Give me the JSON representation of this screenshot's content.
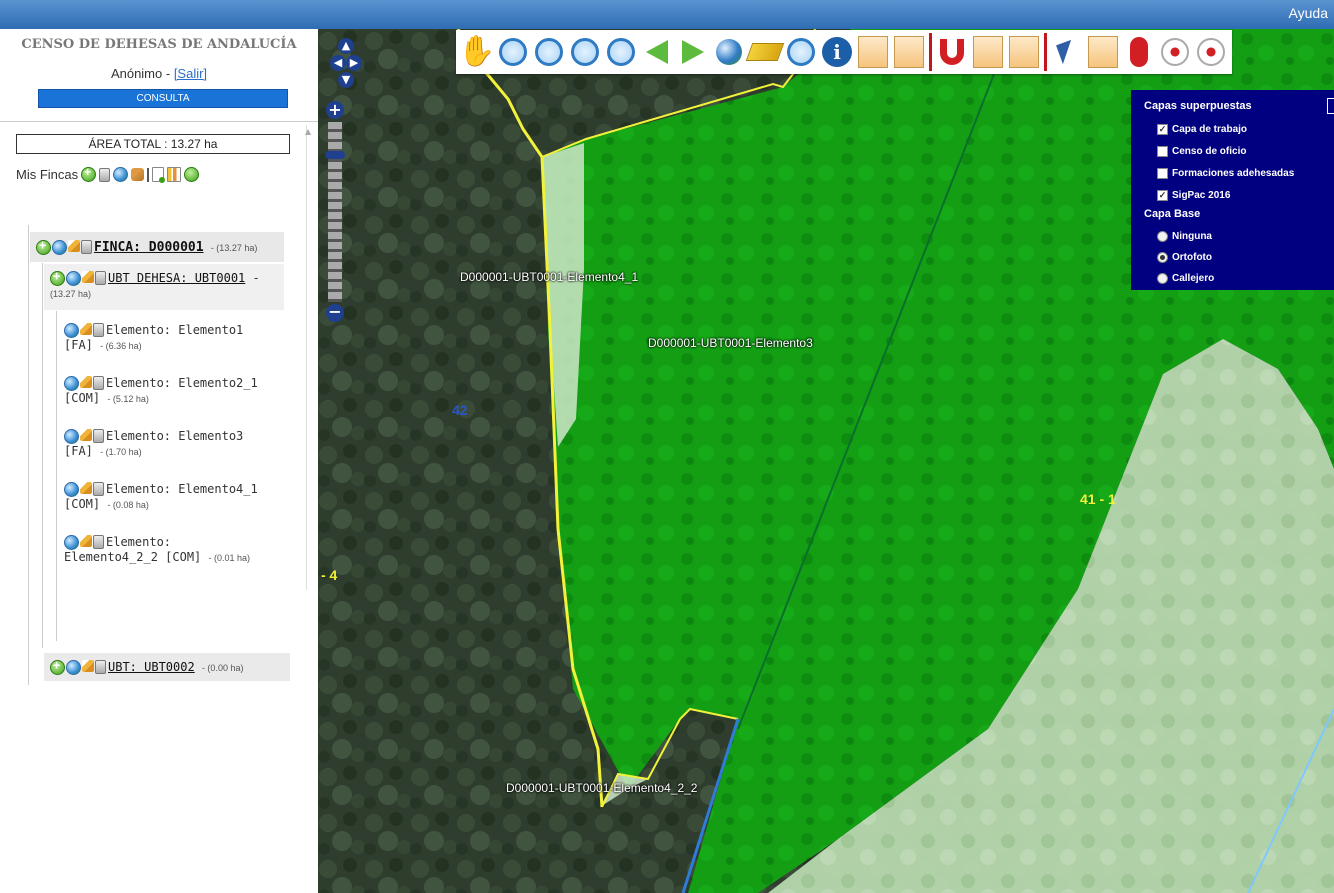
{
  "header": {
    "help_label": "Ayuda"
  },
  "sidebar": {
    "title": "CENSO DE DEHESAS DE ANDALUCÍA",
    "user": "Anónimo",
    "logout_label": "[Salir]",
    "mode": "CONSULTA",
    "area_total": "ÁREA TOTAL : 13.27 ha",
    "mis_fincas_label": "Mis Fincas",
    "tree": {
      "finca": {
        "label": "FINCA: D000001",
        "area": "- (13.27 ha)"
      },
      "ubt1": {
        "label": "UBT DEHESA: UBT0001",
        "suffix": "-",
        "area": "(13.27 ha)"
      },
      "elements": [
        {
          "label": "Elemento: Elemento1",
          "tag": "[FA]",
          "area": "- (6.36 ha)"
        },
        {
          "label": "Elemento: Elemento2_1",
          "tag": "[COM]",
          "area": "- (5.12 ha)"
        },
        {
          "label": "Elemento: Elemento3",
          "tag": "[FA]",
          "area": "- (1.70 ha)"
        },
        {
          "label": "Elemento: Elemento4_1",
          "tag": "[COM]",
          "area": "- (0.08 ha)"
        },
        {
          "label": "Elemento:",
          "tag": "Elemento4_2_2 [COM]",
          "area": "- (0.01 ha)"
        }
      ],
      "ubt2": {
        "label": "UBT: UBT0002",
        "area": "- (0.00 ha)"
      }
    }
  },
  "map": {
    "labels": {
      "el4_1": "D000001-UBT0001-Elemento4_1",
      "el3": "D000001-UBT0001-Elemento3",
      "el4_2_2": "D000001-UBT0001-Elemento4_2_2"
    },
    "parcel_numbers": {
      "p42": "42",
      "p41": "41 - 1",
      "p4": "- 4"
    },
    "colors": {
      "parcel_green": "#14a014",
      "parcel_light": "#c8e6c0",
      "boundary_yellow": "#f2f23a",
      "blue_line": "#2f7bd8",
      "panel_bg": "#000080"
    },
    "layer_panel": {
      "overlays_title": "Capas superpuestas",
      "overlays": [
        {
          "label": "Capa de trabajo",
          "checked": true
        },
        {
          "label": "Censo de oficio",
          "checked": false
        },
        {
          "label": "Formaciones adehesadas",
          "checked": false
        },
        {
          "label": "SigPac 2016",
          "checked": true
        }
      ],
      "base_title": "Capa Base",
      "base": [
        {
          "label": "Ninguna",
          "selected": false
        },
        {
          "label": "Ortofoto",
          "selected": true
        },
        {
          "label": "Callejero",
          "selected": false
        }
      ]
    }
  }
}
